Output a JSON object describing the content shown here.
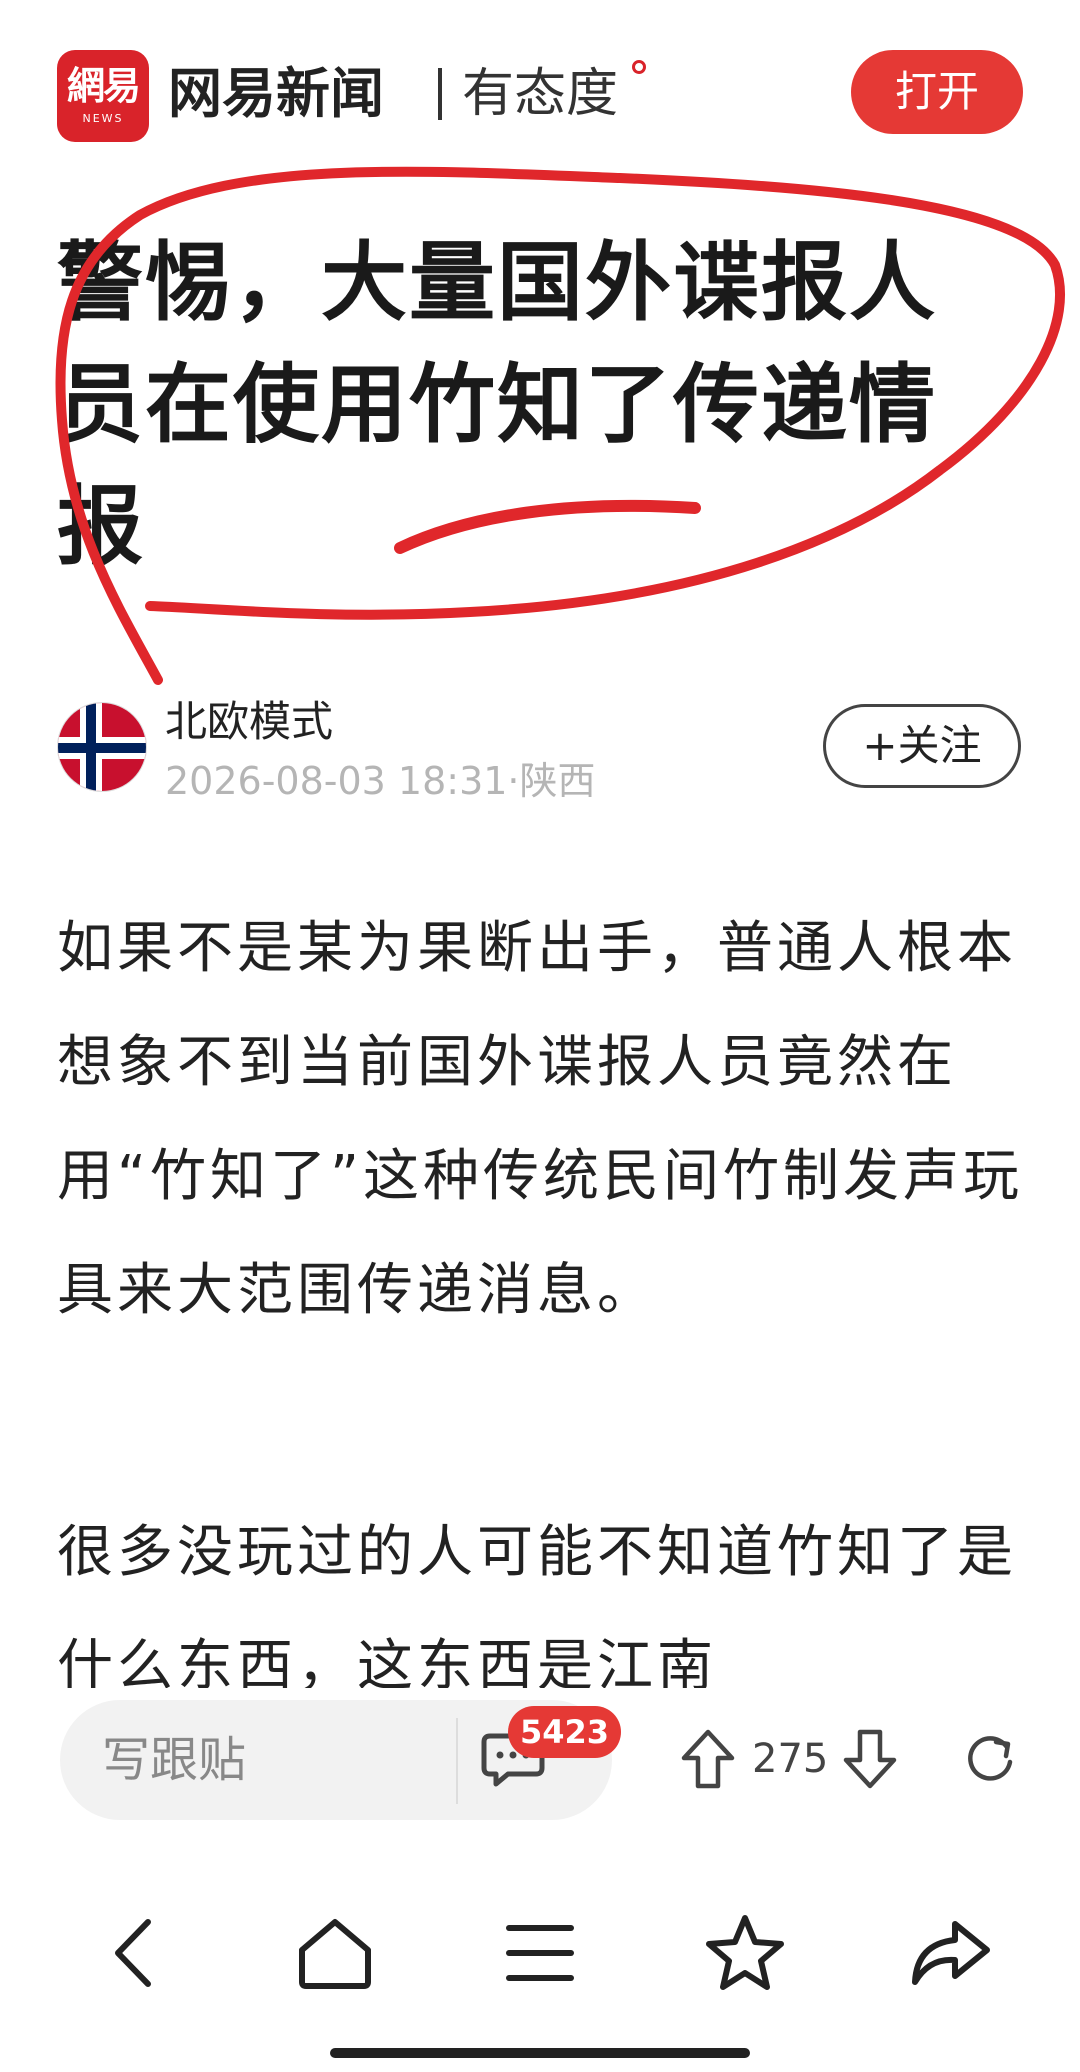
{
  "header": {
    "logo_text": "網易",
    "logo_sub": "NEWS",
    "brand_name": "网易新闻",
    "slogan": "有态度",
    "open_label": "打开",
    "accent_color": "#e53935"
  },
  "article": {
    "title": "警惕，大量国外谍报人员在使用竹知了传递情报",
    "author": {
      "name": "北欧模式",
      "meta": "2026-08-03 18:31·陕西",
      "avatar_icon": "norway-flag-icon"
    },
    "follow_label": "+关注",
    "paragraphs": [
      "如果不是某为果断出手，普通人根本想象不到当前国外谍报人员竟然在用“竹知了”这种传统民间竹制发声玩具来大范围传递消息。",
      "很多没玩过的人可能不知道竹知了是什么东西，这东西是江南"
    ]
  },
  "comment_bar": {
    "placeholder": "写跟贴",
    "comment_count": "5423",
    "vote_count": "275"
  },
  "nav": {
    "icons": [
      "back-icon",
      "home-icon",
      "menu-icon",
      "star-icon",
      "share-icon"
    ]
  }
}
